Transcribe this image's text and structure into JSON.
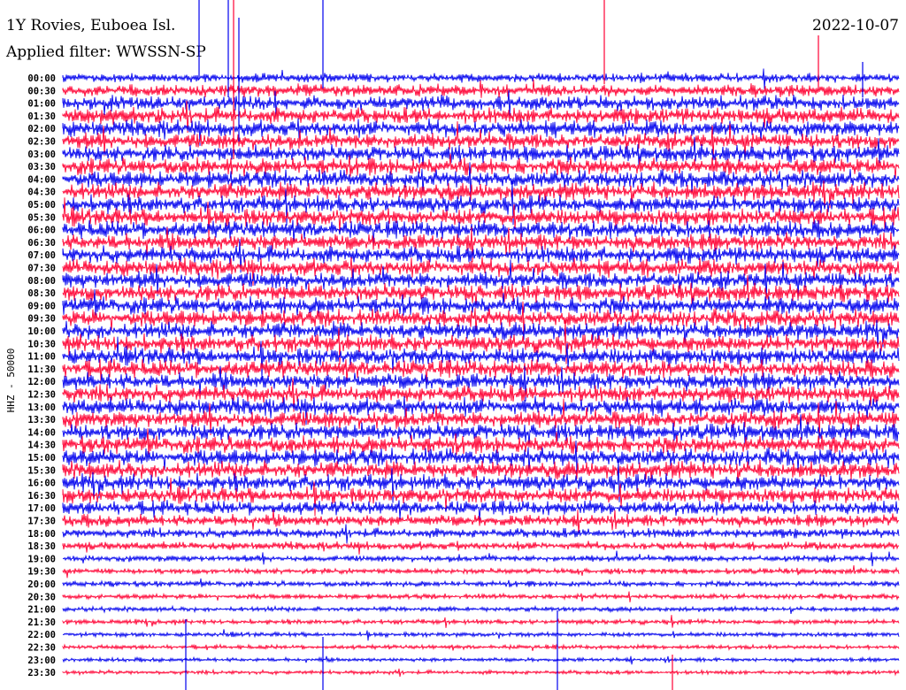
{
  "header": {
    "station": "1Y Rovies, Euboea Isl.",
    "filter": "Applied filter: WWSSN-SP",
    "date": "2022-10-07"
  },
  "chart_data": {
    "type": "line",
    "title": "1Y Rovies, Euboea Isl.",
    "subtitle": "Applied filter: WWSSN-SP",
    "date": "2022-10-07",
    "ylabel": "HHZ - 50000",
    "row_labels": [
      "00:00",
      "00:30",
      "01:00",
      "01:30",
      "02:00",
      "02:30",
      "03:00",
      "03:30",
      "04:00",
      "04:30",
      "05:00",
      "05:30",
      "06:00",
      "06:30",
      "07:00",
      "07:30",
      "08:00",
      "08:30",
      "09:00",
      "09:30",
      "10:00",
      "10:30",
      "11:00",
      "11:30",
      "12:00",
      "12:30",
      "13:00",
      "13:30",
      "14:00",
      "14:30",
      "15:00",
      "15:30",
      "16:00",
      "16:30",
      "17:00",
      "17:30",
      "18:00",
      "18:30",
      "19:00",
      "19:30",
      "20:00",
      "20:30",
      "21:00",
      "21:30",
      "22:00",
      "22:30",
      "23:00",
      "23:30"
    ],
    "row_amplitude": [
      0.55,
      0.75,
      0.9,
      1.0,
      1.0,
      1.0,
      1.0,
      1.05,
      1.05,
      1.05,
      1.05,
      1.05,
      1.05,
      1.05,
      1.05,
      1.05,
      1.05,
      1.05,
      1.05,
      1.05,
      1.05,
      1.05,
      1.05,
      1.05,
      1.05,
      1.05,
      1.05,
      1.05,
      1.05,
      1.05,
      1.05,
      1.05,
      1.0,
      0.95,
      0.85,
      0.75,
      0.6,
      0.5,
      0.4,
      0.35,
      0.35,
      0.32,
      0.3,
      0.3,
      0.28,
      0.26,
      0.25,
      0.25
    ],
    "series_colors": [
      "#0000ee",
      "#ff0033"
    ],
    "grid": false
  }
}
